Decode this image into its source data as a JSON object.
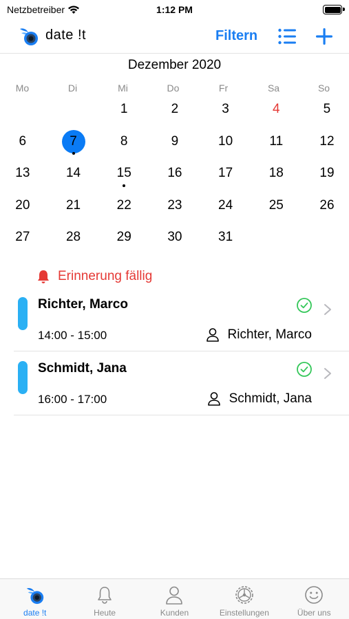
{
  "status_bar": {
    "carrier": "Netzbetreiber",
    "time": "1:12 PM",
    "battery_level": 1.0
  },
  "navbar": {
    "app_name": "date !t",
    "filter_label": "Filtern",
    "icons": [
      "app-logo-icon",
      "list-icon",
      "plus-icon"
    ],
    "accent_color": "#1a7ef2"
  },
  "calendar": {
    "month_title": "Dezember 2020",
    "weekdays": [
      "Mo",
      "Di",
      "Mi",
      "Do",
      "Fr",
      "Sa",
      "So"
    ],
    "leading_blanks": 2,
    "days": [
      {
        "n": "1"
      },
      {
        "n": "2"
      },
      {
        "n": "3"
      },
      {
        "n": "4",
        "red": true
      },
      {
        "n": "5"
      },
      {
        "n": "6"
      },
      {
        "n": "7",
        "selected": true,
        "dot": true
      },
      {
        "n": "8"
      },
      {
        "n": "9"
      },
      {
        "n": "10"
      },
      {
        "n": "11"
      },
      {
        "n": "12"
      },
      {
        "n": "13"
      },
      {
        "n": "14"
      },
      {
        "n": "15",
        "dot": true
      },
      {
        "n": "16"
      },
      {
        "n": "17"
      },
      {
        "n": "18"
      },
      {
        "n": "19"
      },
      {
        "n": "20"
      },
      {
        "n": "21"
      },
      {
        "n": "22"
      },
      {
        "n": "23"
      },
      {
        "n": "24"
      },
      {
        "n": "25"
      },
      {
        "n": "26"
      },
      {
        "n": "27"
      },
      {
        "n": "28"
      },
      {
        "n": "29"
      },
      {
        "n": "30"
      },
      {
        "n": "31"
      }
    ],
    "selected_color": "#0a7bf5",
    "highlight_color": "#e53935"
  },
  "reminder": {
    "text": "Erinnerung fällig",
    "icon": "bell-icon",
    "color": "#e53935"
  },
  "appointments": [
    {
      "name": "Richter, Marco",
      "time": "14:00 - 15:00",
      "customer": "Richter, Marco",
      "status_icon": "check-circle-icon",
      "bar_color": "#2ab0f4"
    },
    {
      "name": "Schmidt, Jana",
      "time": "16:00 - 17:00",
      "customer": "Schmidt, Jana",
      "status_icon": "check-circle-icon",
      "bar_color": "#2ab0f4"
    }
  ],
  "tabbar": {
    "tabs": [
      {
        "label": "date !t",
        "icon": "app-logo-icon",
        "active": true
      },
      {
        "label": "Heute",
        "icon": "bell-icon"
      },
      {
        "label": "Kunden",
        "icon": "person-icon"
      },
      {
        "label": "Einstellungen",
        "icon": "gear-icon"
      },
      {
        "label": "Über uns",
        "icon": "smiley-icon"
      }
    ]
  }
}
